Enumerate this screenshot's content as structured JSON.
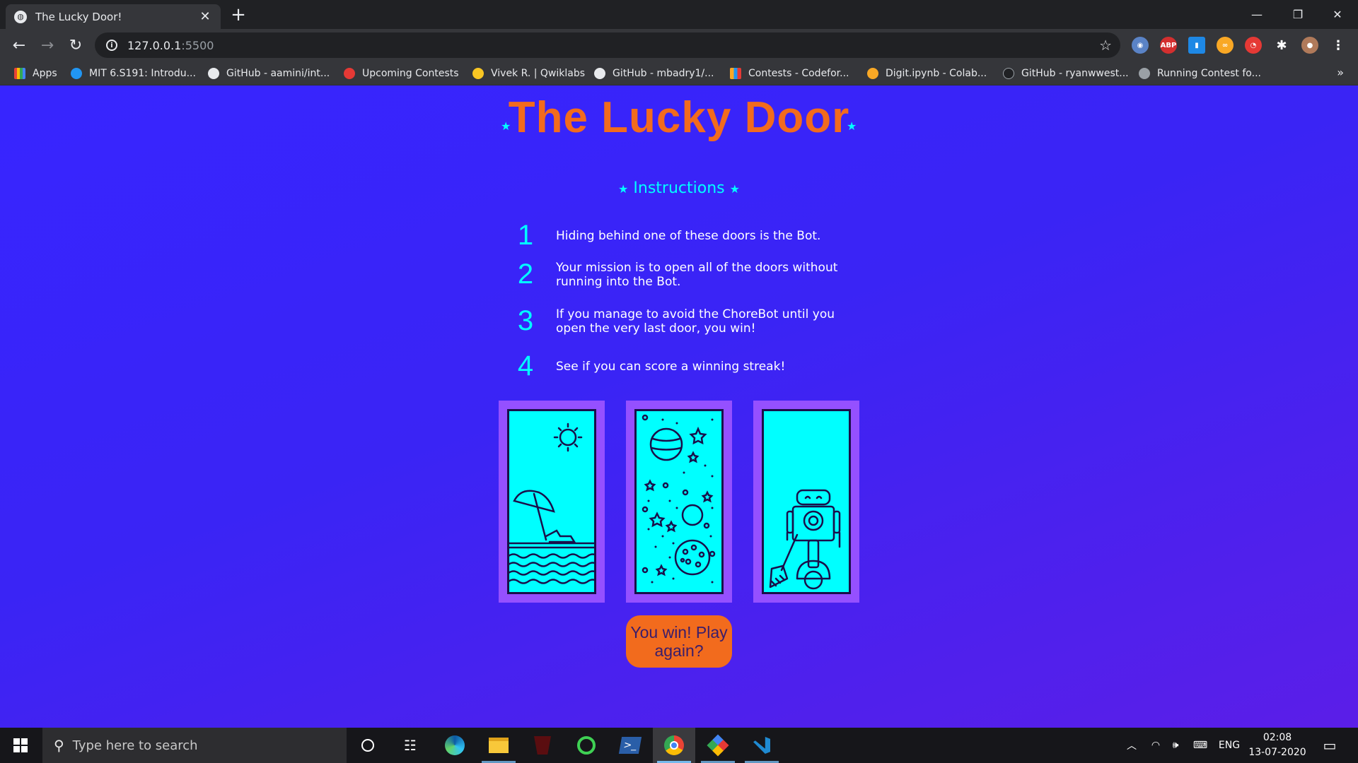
{
  "browser": {
    "tab_title": "The Lucky Door!",
    "url_host": "127.0.0.1",
    "url_port": ":5500",
    "bookmarks": [
      "Apps",
      "MIT 6.S191: Introdu...",
      "GitHub - aamini/int...",
      "Upcoming Contests",
      "Vivek R. | Qwiklabs",
      "GitHub - mbadry1/...",
      "Contests - Codefor...",
      "Digit.ipynb - Colab...",
      "GitHub - ryanwwest...",
      "Running Contest fo..."
    ],
    "extensions": [
      "ABP"
    ]
  },
  "page": {
    "title": "The Lucky Door",
    "instructions_heading": "Instructions",
    "instructions": [
      {
        "num": "1",
        "text": "Hiding behind one of these doors is the Bot."
      },
      {
        "num": "2",
        "text": "Your mission is to open all of the doors without running into the Bot."
      },
      {
        "num": "3",
        "text": "If you manage to avoid the ChoreBot until you open the very last door, you win!"
      },
      {
        "num": "4",
        "text": "See if you can score a winning streak!"
      }
    ],
    "doors": [
      "beach-door",
      "space-door",
      "robot-door"
    ],
    "play_button": "You win! Play again?"
  },
  "colors": {
    "title": "#f26b1d",
    "accent": "#00ffff",
    "door_frame": "#9550ff",
    "background": "#3725ff"
  },
  "taskbar": {
    "search_placeholder": "Type here to search",
    "language": "ENG",
    "time": "02:08",
    "date": "13-07-2020"
  }
}
